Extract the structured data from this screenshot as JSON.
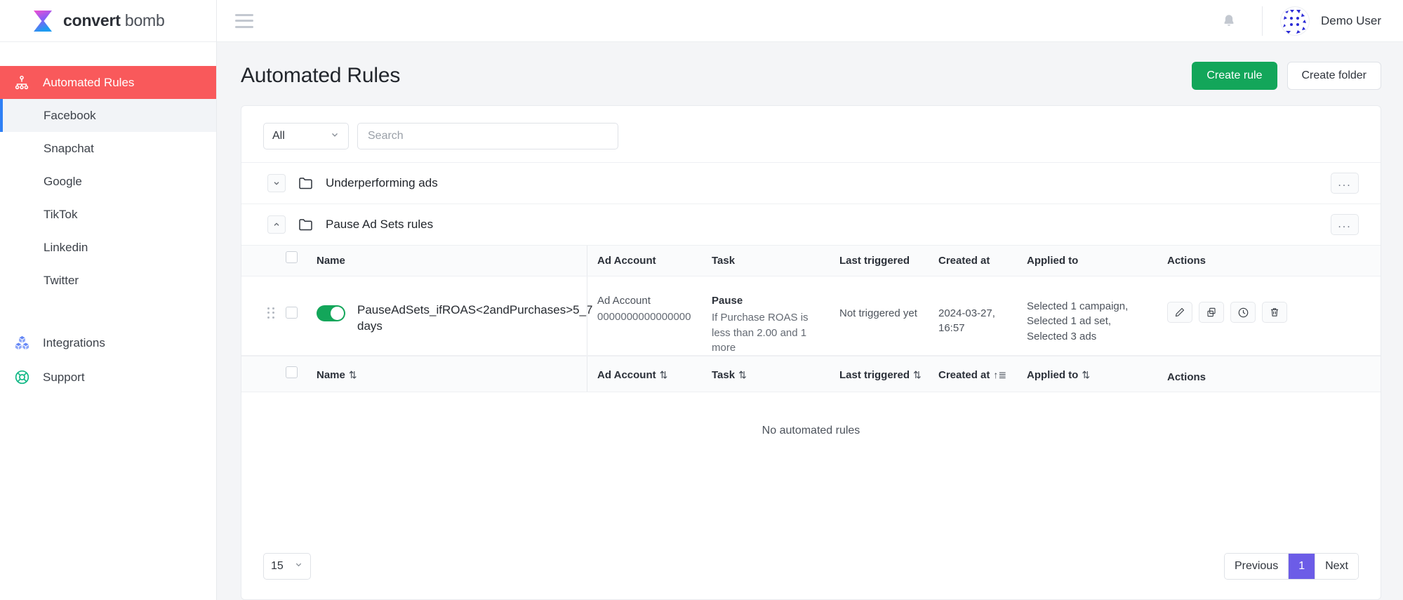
{
  "brand": {
    "name_bold": "convert",
    "name_light": " bomb",
    "logo_icon": "hourglass-logo"
  },
  "topbar": {
    "menu_icon": "hamburger-icon",
    "notification_icon": "bell-icon",
    "avatar_icon": "user-avatar",
    "username": "Demo User"
  },
  "sidebar": {
    "primary": {
      "label": "Automated Rules",
      "icon": "sitemap-icon"
    },
    "channels": [
      {
        "label": "Facebook",
        "active": true
      },
      {
        "label": "Snapchat",
        "active": false
      },
      {
        "label": "Google",
        "active": false
      },
      {
        "label": "TikTok",
        "active": false
      },
      {
        "label": "Linkedin",
        "active": false
      },
      {
        "label": "Twitter",
        "active": false
      }
    ],
    "bottom": [
      {
        "label": "Integrations",
        "icon": "boxes-icon"
      },
      {
        "label": "Support",
        "icon": "lifebuoy-icon"
      }
    ]
  },
  "page": {
    "title": "Automated Rules",
    "create_rule_label": "Create rule",
    "create_folder_label": "Create folder"
  },
  "filters": {
    "type_value": "All",
    "type_chevron": "chevron-down-icon",
    "search_placeholder": "Search",
    "search_value": ""
  },
  "folders": [
    {
      "name": "Underperforming ads",
      "expanded": false,
      "chevron": "chevron-down-icon",
      "menu": "..."
    },
    {
      "name": "Pause Ad Sets rules",
      "expanded": true,
      "chevron": "chevron-up-icon",
      "menu": "..."
    }
  ],
  "table": {
    "headers": {
      "name": "Name",
      "ad_account": "Ad Account",
      "task": "Task",
      "last_triggered": "Last triggered",
      "created_at": "Created at",
      "applied_to": "Applied to",
      "actions": "Actions"
    },
    "sort_icon_neutral": "⇅",
    "sort_icon_active": "↑≣",
    "rows": [
      {
        "enabled": true,
        "checked": false,
        "name": "PauseAdSets_ifROAS<2andPurchases>5_7 days",
        "ad_account_label": "Ad Account",
        "ad_account_id": "0000000000000000",
        "task_title": "Pause",
        "task_desc": "If Purchase ROAS is less than 2.00 and 1 more",
        "last_triggered": "Not triggered yet",
        "created_at": "2024-03-27, 16:57",
        "applied_to": "Selected 1 campaign, Selected 1 ad set, Selected 3 ads",
        "actions": [
          "edit-icon",
          "duplicate-icon",
          "history-icon",
          "delete-icon"
        ]
      }
    ],
    "empty_text": "No automated rules"
  },
  "pagination": {
    "per_page": "15",
    "per_page_chevron": "chevron-down-icon",
    "previous_label": "Previous",
    "current_page": "1",
    "next_label": "Next"
  },
  "colors": {
    "accent_red": "#f9595b",
    "accent_green": "#13a65a",
    "accent_purple": "#6c5ce7",
    "accent_blue": "#2f80f5"
  }
}
